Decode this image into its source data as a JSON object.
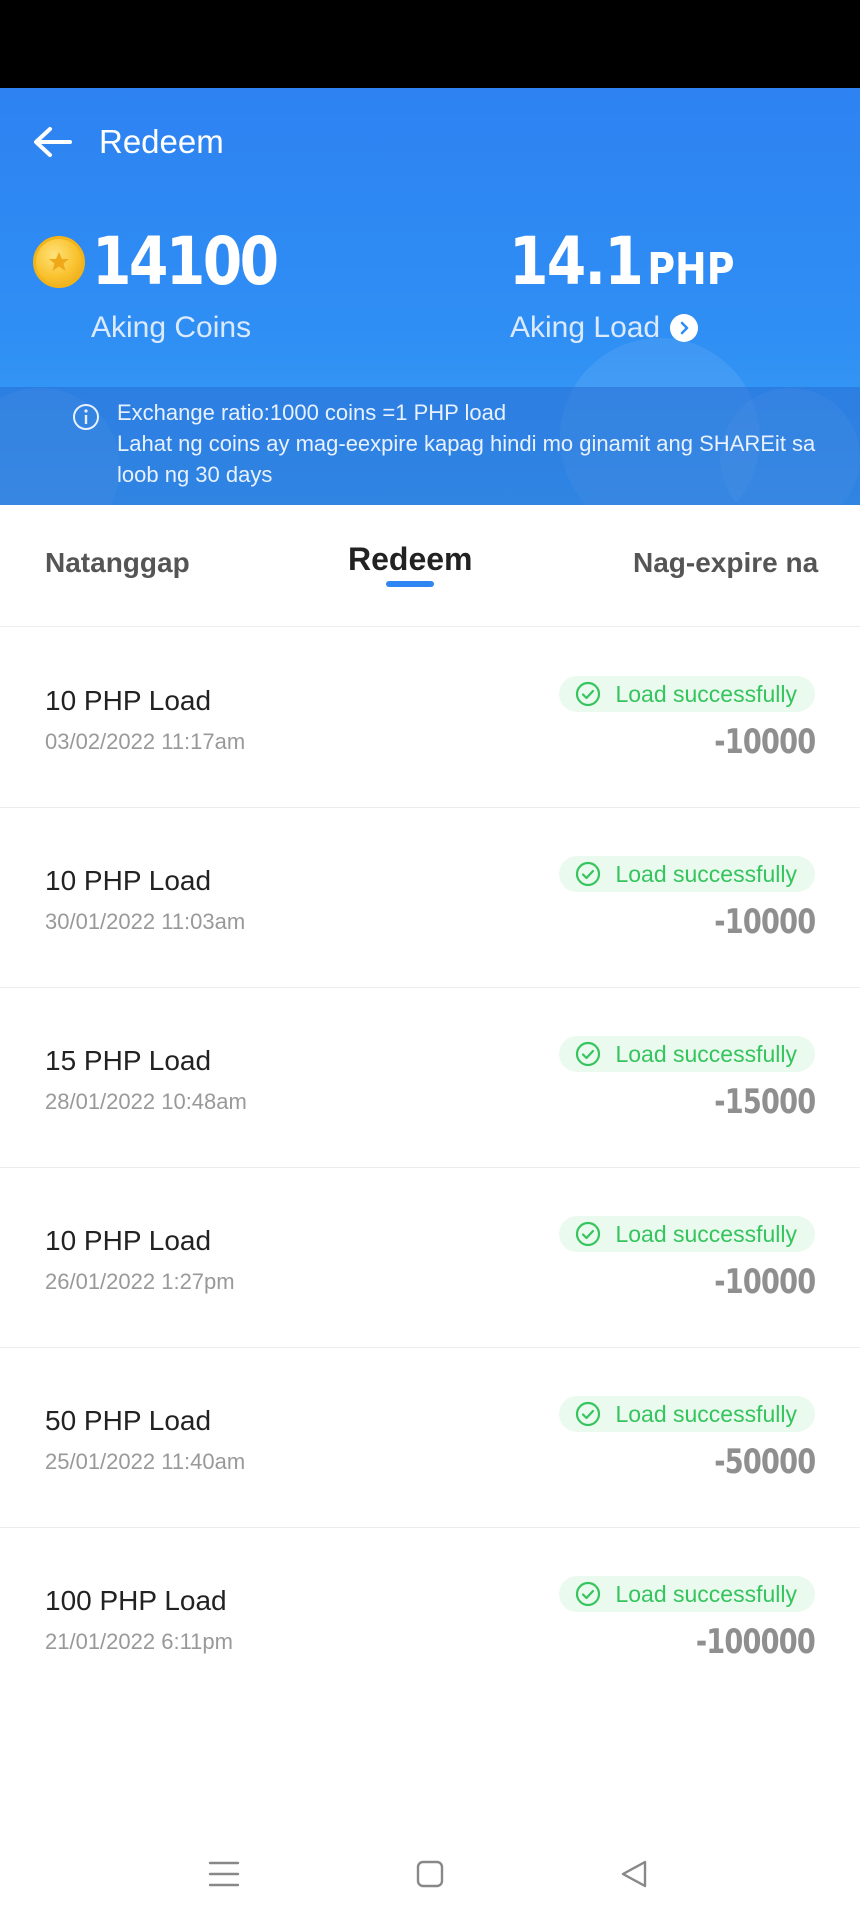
{
  "header": {
    "title": "Redeem",
    "coins_value": "14100",
    "coins_label": "Aking Coins",
    "load_value": "14.1",
    "load_unit": "PHP",
    "load_label": "Aking Load",
    "info_text": "Exchange ratio:1000 coins =1 PHP load\nLahat ng coins ay mag-eexpire kapag hindi mo ginamit ang SHAREit sa loob ng 30 days"
  },
  "tabs": [
    {
      "label": "Natanggap",
      "active": false
    },
    {
      "label": "Redeem",
      "active": true
    },
    {
      "label": "Nag-expire na",
      "active": false
    }
  ],
  "transactions": [
    {
      "title": "10 PHP Load",
      "date": "03/02/2022 11:17am",
      "status": "Load successfully",
      "amount": "-10000"
    },
    {
      "title": "10 PHP Load",
      "date": "30/01/2022 11:03am",
      "status": "Load successfully",
      "amount": "-10000"
    },
    {
      "title": "15 PHP Load",
      "date": "28/01/2022 10:48am",
      "status": "Load successfully",
      "amount": "-15000"
    },
    {
      "title": "10 PHP Load",
      "date": "26/01/2022 1:27pm",
      "status": "Load successfully",
      "amount": "-10000"
    },
    {
      "title": "50 PHP Load",
      "date": "25/01/2022 11:40am",
      "status": "Load successfully",
      "amount": "-50000"
    },
    {
      "title": "100 PHP Load",
      "date": "21/01/2022 6:11pm",
      "status": "Load successfully",
      "amount": "-100000"
    }
  ],
  "colors": {
    "header_blue": "#2f8ff4",
    "success_green": "#35c45d",
    "tab_indicator": "#2f86f2"
  },
  "icons": {
    "back": "back-arrow-icon",
    "coin": "coin-icon",
    "load_more": "chevron-right-circle-icon",
    "info": "info-icon",
    "status": "check-circle-icon",
    "nav_menu": "menu-icon",
    "nav_home": "home-square-icon",
    "nav_back": "back-triangle-icon"
  }
}
